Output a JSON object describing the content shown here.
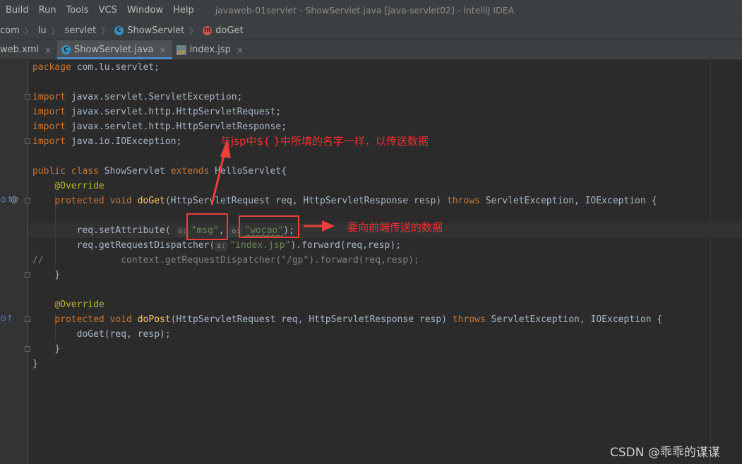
{
  "menu": [
    "Build",
    "Run",
    "Tools",
    "VCS",
    "Window",
    "Help"
  ],
  "window_title": "javaweb-01servlet - ShowServlet.java [java-servlet02] - IntelliJ IDEA",
  "breadcrumb": {
    "items": [
      "com",
      "lu",
      "servlet",
      "ShowServlet",
      "doGet"
    ],
    "class_icon": "C",
    "method_icon": "m"
  },
  "tabs": [
    {
      "label": "web.xml",
      "close": "×"
    },
    {
      "label": "ShowServlet.java",
      "close": "×",
      "icon": "C"
    },
    {
      "label": "index.jsp",
      "close": "×",
      "icon": "JSP"
    }
  ],
  "code": {
    "package_kw": "package",
    "package_name": " com.lu.servlet;",
    "imports": [
      " javax.servlet.ServletException;",
      " javax.servlet.http.HttpServletRequest;",
      " javax.servlet.http.HttpServletResponse;",
      " java.io.IOException;"
    ],
    "import_kw": "import",
    "class_decl": {
      "kw1": "public class",
      "name": " ShowServlet ",
      "kw2": "extends",
      "parent": " HelloServlet{"
    },
    "override": "@Override",
    "doget": {
      "kw": "protected void",
      "name": "doGet",
      "params": "(HttpServletRequest req, HttpServletResponse resp) ",
      "throws": "throws",
      "ex": " ServletException, IOException {"
    },
    "set_attr": {
      "prefix": "req.setAttribute(",
      "hint1": "s:",
      "arg1": "\"msg\"",
      "comma": ",",
      "hint2": "o:",
      "arg2": "\"wocao\"",
      "suffix": ");"
    },
    "dispatch": {
      "prefix": "req.getRequestDispatcher(",
      "hint": "s:",
      "arg": "\"index.jsp\"",
      "suffix": ").forward(req,resp);"
    },
    "comment": "//              context.getRequestDispatcher(\"/gp\").forward(req,resp);",
    "close_brace": "}",
    "dopost": {
      "kw": "protected void",
      "name": "doPost",
      "params": "(HttpServletRequest req, HttpServletResponse resp) ",
      "throws": "throws",
      "ex": " ServletException, IOException {"
    },
    "dopost_body": "doGet(req, resp);"
  },
  "annotations": {
    "top_note": "与jsp中${ }中所填的名字一样，以传送数据",
    "right_note": "要向前端传送的数据",
    "arrow_color": "#e8413c"
  },
  "gutter": {
    "at_sign": "@"
  },
  "watermark": "CSDN @乖乖的谋谋"
}
